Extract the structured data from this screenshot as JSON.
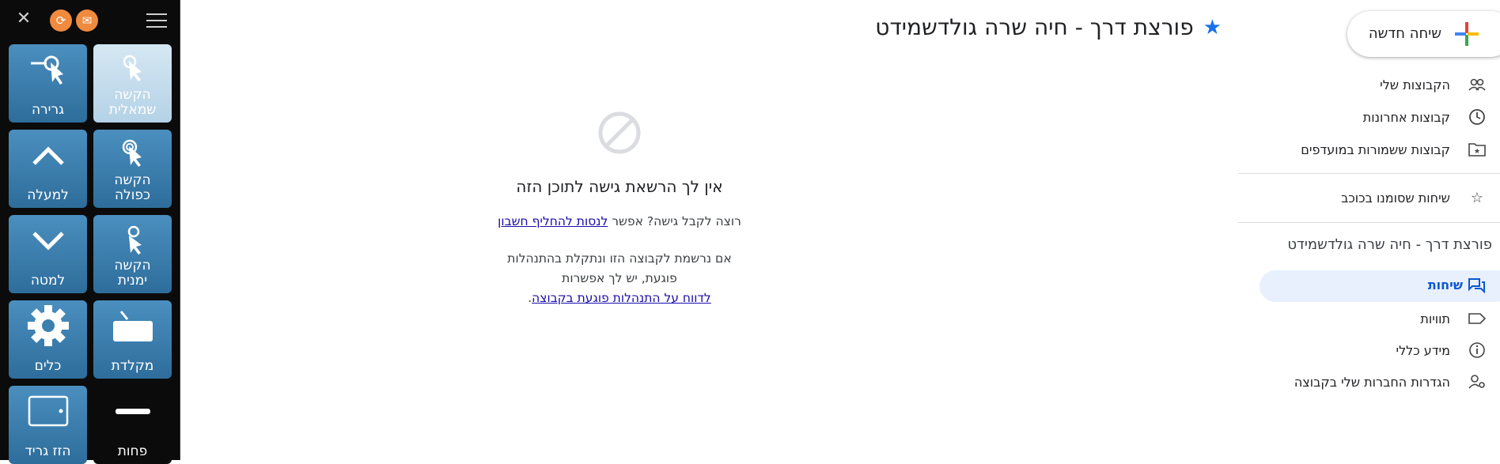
{
  "panel": {
    "tiles": [
      {
        "line1": "הקשה",
        "line2": "שמאלית"
      },
      {
        "line1": "גרירה",
        "line2": ""
      },
      {
        "line1": "הקשה",
        "line2": "כפולה"
      },
      {
        "line1": "למעלה",
        "line2": ""
      },
      {
        "line1": "הקשה",
        "line2": "ימנית"
      },
      {
        "line1": "למטה",
        "line2": ""
      },
      {
        "line1": "מקלדת",
        "line2": ""
      },
      {
        "line1": "כלים",
        "line2": ""
      },
      {
        "line1": "פחות",
        "line2": ""
      },
      {
        "line1": "הזז גריד",
        "line2": ""
      }
    ],
    "icons": {
      "close": "close-icon",
      "refresh": "refresh-icon",
      "mail": "mail-icon",
      "menu": "hamburger-menu-icon"
    }
  },
  "header": {
    "title": "פורצת דרך - חיה שרה גולדשמידט"
  },
  "denied": {
    "title": "אין לך הרשאת גישה לתוכן הזה",
    "p1_text": "רוצה לקבל גישה? אפשר ",
    "p1_link": "לנסות להחליף חשבון",
    "p2_line1": "אם נרשמת לקבוצה הזו ונתקלת בהתנהלות",
    "p2_line2": "פוגעת, יש לך אפשרות",
    "p2_link": "לדווח על התנהלות פוגעת בקבוצה",
    "p2_end": "."
  },
  "nav": {
    "new_chat": "שיחה חדשה",
    "my_groups": "הקבוצות שלי",
    "recent_groups": "קבוצות אחרונות",
    "saved_groups": "קבוצות ששמורות במועדפים",
    "starred_chats": "שיחות שסומנו בכוכב",
    "group_name": "פורצת דרך - חיה שרה גולדשמידט",
    "chats": "שיחות",
    "labels": "תוויות",
    "about": "מידע כללי",
    "membership_settings": "הגדרות החברות שלי בקבוצה"
  },
  "colors": {
    "accent": "#1a73e8",
    "active_bg": "#e8f0fe",
    "tile_blue": "#3a7fb0",
    "orange": "#f08a3e"
  }
}
